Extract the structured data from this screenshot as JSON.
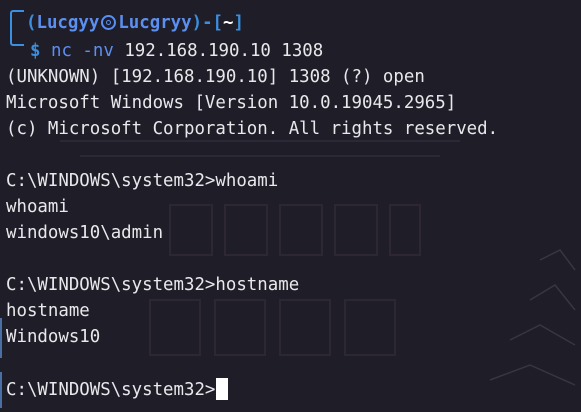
{
  "prompt": {
    "open_paren": "┌──(",
    "user": "Lucgyy",
    "host": "Lucgryy",
    "close_paren": ")-[",
    "path": "~",
    "close_bracket": "]",
    "dollar": "$",
    "command_name": "nc",
    "command_flag": "-nv",
    "command_args": "192.168.190.10 1308"
  },
  "output_lines": [
    "(UNKNOWN) [192.168.190.10] 1308 (?) open",
    "Microsoft Windows [Version 10.0.19045.2965]",
    "(c) Microsoft Corporation. All rights reserved.",
    "",
    "C:\\WINDOWS\\system32>whoami",
    "whoami",
    "windows10\\admin",
    "",
    "C:\\WINDOWS\\system32>hostname",
    "hostname",
    "Windows10",
    "",
    "C:\\WINDOWS\\system32>"
  ],
  "colors": {
    "background": "#1f1d27",
    "prompt_blue": "#3b8fe0",
    "text": "#e8e8ec"
  }
}
